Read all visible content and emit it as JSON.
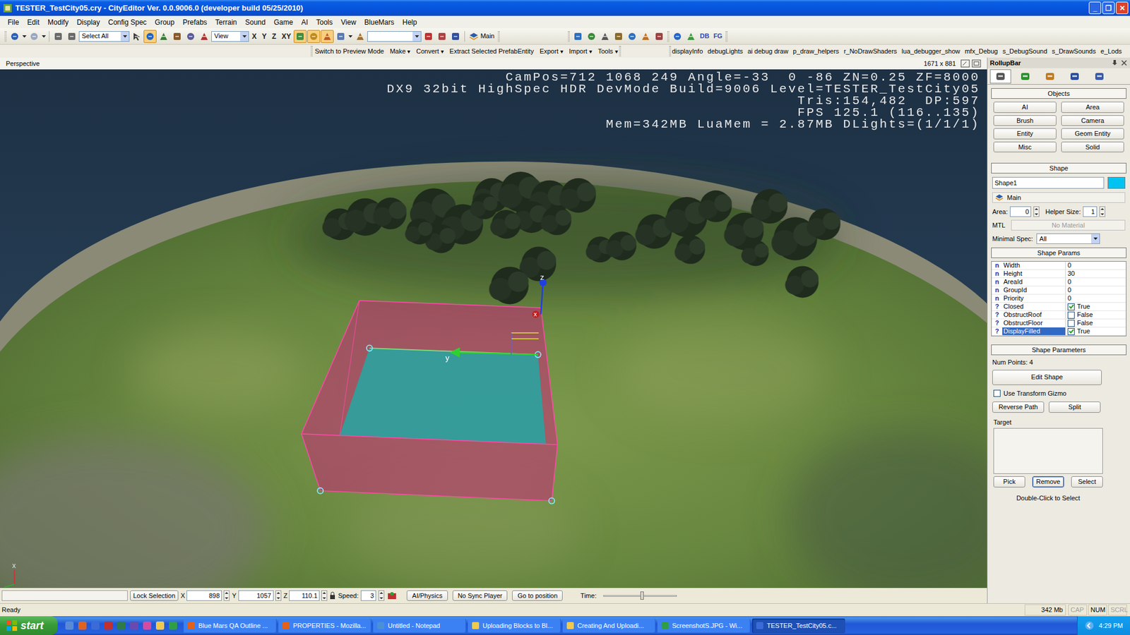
{
  "window": {
    "title": "TESTER_TestCity05.cry - CityEditor Ver. 0.0.9006.0 (developer build 05/25/2010)",
    "controls": [
      "_",
      "❐",
      "✕"
    ]
  },
  "menu": [
    "File",
    "Edit",
    "Modify",
    "Display",
    "Config Spec",
    "Group",
    "Prefabs",
    "Terrain",
    "Sound",
    "Game",
    "AI",
    "Tools",
    "View",
    "BlueMars",
    "Help"
  ],
  "toolbar": {
    "select_filter": "Select All",
    "edit_tools": [
      {
        "selected": false
      },
      {
        "selected": true
      },
      {
        "selected": false
      },
      {
        "selected": false
      },
      {
        "selected": false
      },
      {
        "selected": false
      }
    ],
    "ref_coord": "View",
    "axes": [
      "X",
      "Y",
      "Z",
      "XY"
    ],
    "snap_tools": [
      {
        "selected": true
      },
      {
        "selected": true
      },
      {
        "selected": true
      },
      {
        "selected": false
      }
    ],
    "layer": "Main",
    "extras": [
      "DB",
      "FG"
    ]
  },
  "toolbar2": {
    "commands": [
      {
        "label": "Switch to Preview Mode",
        "dropdown": false
      },
      {
        "label": "Make",
        "dropdown": true
      },
      {
        "label": "Convert",
        "dropdown": true
      },
      {
        "label": "Extract Selected PrefabEntity",
        "dropdown": false
      },
      {
        "label": "Export",
        "dropdown": true
      },
      {
        "label": "Import",
        "dropdown": true
      },
      {
        "label": "Tools",
        "dropdown": true
      }
    ],
    "dropdown_glyph": "▾",
    "cvars": [
      "displayInfo",
      "debugLights",
      "ai debug draw",
      "p_draw_helpers",
      "r_NoDrawShaders",
      "lua_debugger_show",
      "mfx_Debug",
      "s_DebugSound",
      "s_DrawSounds",
      "e_Lods"
    ]
  },
  "viewport": {
    "label": "Perspective",
    "resolution": "1671 x 881",
    "hud": [
      "CamPos=712 1068 249 Angle=-33  0 -86 ZN=0.25 ZF=8000",
      "DX9 32bit HighSpec HDR DevMode Build=9006 Level=TESTER_TestCity05",
      "Tris:154,482  DP:597",
      "FPS 125.1 (116..135)",
      "Mem=342MB LuaMem = 2.87MB DLights=(1/1/1)"
    ],
    "gizmo_labels": {
      "x": "x",
      "y": "y",
      "z": "z"
    },
    "corner_axis": "x"
  },
  "bottom_bar": {
    "lock": "Lock Selection",
    "coords": [
      {
        "axis": "X",
        "value": "898"
      },
      {
        "axis": "Y",
        "value": "1057"
      },
      {
        "axis": "Z",
        "value": "110.1"
      }
    ],
    "speed_label": "Speed:",
    "speed": "3",
    "buttons": [
      "AI/Physics",
      "No Sync Player",
      "Go to position"
    ],
    "time_label": "Time:",
    "time_level": 0.5
  },
  "rollup": {
    "title": "RollupBar",
    "tabs": [
      {
        "selected": true
      },
      {
        "selected": false
      },
      {
        "selected": false
      },
      {
        "selected": false
      },
      {
        "selected": false
      }
    ],
    "objects": {
      "title": "Objects",
      "buttons": [
        "AI",
        "Area",
        "Brush",
        "Camera",
        "Entity",
        "Geom Entity",
        "Misc",
        "Solid"
      ]
    },
    "shape": {
      "title": "Shape",
      "name": "Shape1",
      "color": "#00c3f2",
      "layer": "Main",
      "area_label": "Area:",
      "area": "0",
      "helper_label": "Helper Size:",
      "helper": "1",
      "mtl_label": "MTL",
      "mtl": "No Material",
      "spec_label": "Minimal Spec:",
      "spec": "All"
    },
    "shape_params": {
      "title": "Shape Params",
      "rows": [
        {
          "icon": "n",
          "name": "Width",
          "value": "0",
          "kind": "number",
          "selected": false
        },
        {
          "icon": "n",
          "name": "Height",
          "value": "30",
          "kind": "number",
          "selected": false
        },
        {
          "icon": "n",
          "name": "AreaId",
          "value": "0",
          "kind": "number",
          "selected": false
        },
        {
          "icon": "n",
          "name": "GroupId",
          "value": "0",
          "kind": "number",
          "selected": false
        },
        {
          "icon": "n",
          "name": "Priority",
          "value": "0",
          "kind": "number",
          "selected": false
        },
        {
          "icon": "?",
          "name": "Closed",
          "value": "True",
          "kind": "bool",
          "checked": true,
          "selected": false
        },
        {
          "icon": "?",
          "name": "ObstructRoof",
          "value": "False",
          "kind": "bool",
          "checked": false,
          "selected": false
        },
        {
          "icon": "?",
          "name": "ObstructFloor",
          "value": "False",
          "kind": "bool",
          "checked": false,
          "selected": false
        },
        {
          "icon": "?",
          "name": "DisplayFilled",
          "value": "True",
          "kind": "bool",
          "checked": true,
          "selected": true
        }
      ]
    },
    "shape_parameters": {
      "title": "Shape Parameters",
      "num_points": "Num Points: 4",
      "edit": "Edit Shape",
      "gizmo": {
        "label": "Use Transform Gizmo",
        "checked": false
      },
      "buttons": [
        "Reverse Path",
        "Split"
      ],
      "target_label": "Target",
      "target_buttons": [
        {
          "label": "Pick",
          "selected": false
        },
        {
          "label": "Remove",
          "selected": true
        },
        {
          "label": "Select",
          "selected": false
        }
      ],
      "hint": "Double-Click to Select"
    }
  },
  "status_bar": {
    "text": "Ready",
    "memory": "342 Mb",
    "keys": [
      {
        "label": "CAP",
        "on": false
      },
      {
        "label": "NUM",
        "on": true
      },
      {
        "label": "SCRL",
        "on": false
      }
    ]
  },
  "taskbar": {
    "start": "start",
    "tasks": [
      {
        "label": "Blue Mars QA Outline ...",
        "selected": false
      },
      {
        "label": "PROPERTIES - Mozilla...",
        "selected": false
      },
      {
        "label": "Untitled - Notepad",
        "selected": false
      },
      {
        "label": "Uploading Blocks to Bl...",
        "selected": false
      },
      {
        "label": "Creating And Uploadi...",
        "selected": false
      },
      {
        "label": "ScreenshotS.JPG - Wi...",
        "selected": false
      },
      {
        "label": "TESTER_TestCity05.c...",
        "selected": true
      }
    ],
    "clock": "4:29 PM"
  }
}
